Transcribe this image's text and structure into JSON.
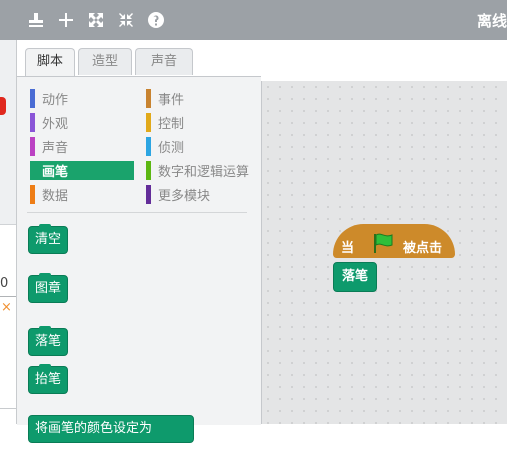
{
  "toolbar": {
    "icons": [
      "stamp-icon",
      "cut-icon",
      "grow-icon",
      "shrink-icon",
      "help-icon"
    ],
    "offline_label": "离线"
  },
  "stage": {
    "coord_text": "0",
    "x_mark": "×"
  },
  "tabs": [
    {
      "label": "脚本",
      "active": true
    },
    {
      "label": "造型",
      "active": false
    },
    {
      "label": "声音",
      "active": false
    }
  ],
  "categories": {
    "left": [
      {
        "label": "动作",
        "color": "#4a6cd4"
      },
      {
        "label": "外观",
        "color": "#8a55d7"
      },
      {
        "label": "声音",
        "color": "#bb42c3"
      },
      {
        "label": "画笔",
        "color": "#0e9a6c",
        "active": true
      },
      {
        "label": "数据",
        "color": "#ee7d16"
      }
    ],
    "right": [
      {
        "label": "事件",
        "color": "#c88330"
      },
      {
        "label": "控制",
        "color": "#e1a91a"
      },
      {
        "label": "侦测",
        "color": "#2ca5e2"
      },
      {
        "label": "数字和逻辑运算",
        "color": "#5cb712"
      },
      {
        "label": "更多模块",
        "color": "#632d99"
      }
    ]
  },
  "palette_blocks": [
    {
      "label": "清空"
    },
    {
      "label": "图章"
    },
    {
      "label": "落笔"
    },
    {
      "label": "抬笔"
    },
    {
      "label": "将画笔的颜色设定为"
    }
  ],
  "script": {
    "hat": {
      "when": "当",
      "clicked": "被点击",
      "flag_color": "#1aa33a"
    },
    "block": "落笔"
  },
  "colors": {
    "pen_green": "#0e9a6c",
    "event_orange": "#cd8a2a",
    "toolbar_grey": "#9ca1a6"
  }
}
